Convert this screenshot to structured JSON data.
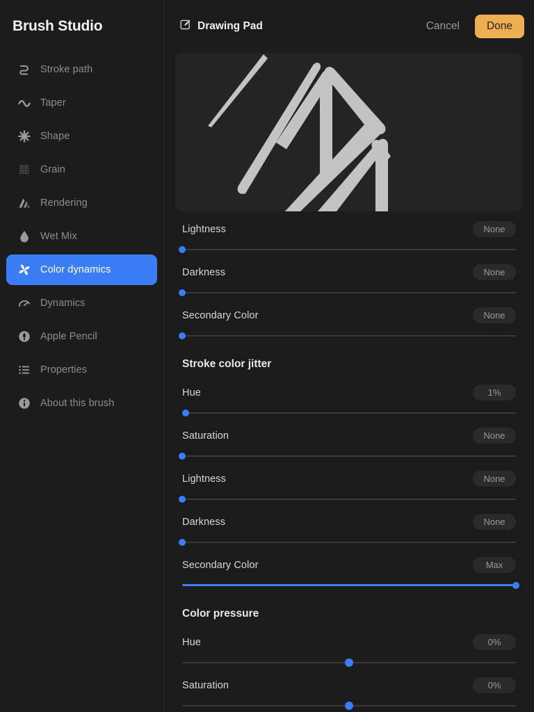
{
  "sidebar": {
    "brand": "Brush Studio",
    "items": [
      {
        "label": "Stroke path",
        "icon": "stroke-path-icon",
        "active": false
      },
      {
        "label": "Taper",
        "icon": "taper-wave-icon",
        "active": false
      },
      {
        "label": "Shape",
        "icon": "shape-starburst-icon",
        "active": false
      },
      {
        "label": "Grain",
        "icon": "grain-texture-icon",
        "active": false
      },
      {
        "label": "Rendering",
        "icon": "rendering-icon",
        "active": false
      },
      {
        "label": "Wet Mix",
        "icon": "water-drop-icon",
        "active": false
      },
      {
        "label": "Color dynamics",
        "icon": "color-dynamics-icon",
        "active": true
      },
      {
        "label": "Dynamics",
        "icon": "speedometer-icon",
        "active": false
      },
      {
        "label": "Apple Pencil",
        "icon": "apple-pencil-icon",
        "active": false
      },
      {
        "label": "Properties",
        "icon": "list-icon",
        "active": false
      },
      {
        "label": "About this brush",
        "icon": "info-icon",
        "active": false
      }
    ]
  },
  "topbar": {
    "edit_icon": "compose-edit-icon",
    "title": "Drawing Pad",
    "cancel_label": "Cancel",
    "done_label": "Done"
  },
  "preview": {
    "name": "brush-stroke-preview",
    "stroke_color": "#c3c3c3",
    "background": "#242424"
  },
  "colors": {
    "accent_blue": "#3b7df5",
    "accent_orange": "#efae52",
    "sidebar_bg": "#1c1c1c",
    "main_bg": "#1b1b1b",
    "pill_bg": "#2a2a2a"
  },
  "sections": [
    {
      "heading": "",
      "rows": [
        {
          "label": "Lightness",
          "value": "None",
          "percent": 0,
          "centered": false
        },
        {
          "label": "Darkness",
          "value": "None",
          "percent": 0,
          "centered": false
        },
        {
          "label": "Secondary Color",
          "value": "None",
          "percent": 0,
          "centered": false
        }
      ]
    },
    {
      "heading": "Stroke color jitter",
      "rows": [
        {
          "label": "Hue",
          "value": "1%",
          "percent": 1,
          "centered": false
        },
        {
          "label": "Saturation",
          "value": "None",
          "percent": 0,
          "centered": false
        },
        {
          "label": "Lightness",
          "value": "None",
          "percent": 0,
          "centered": false
        },
        {
          "label": "Darkness",
          "value": "None",
          "percent": 0,
          "centered": false
        },
        {
          "label": "Secondary Color",
          "value": "Max",
          "percent": 100,
          "centered": false
        }
      ]
    },
    {
      "heading": "Color pressure",
      "rows": [
        {
          "label": "Hue",
          "value": "0%",
          "percent": 50,
          "centered": true
        },
        {
          "label": "Saturation",
          "value": "0%",
          "percent": 50,
          "centered": true
        }
      ]
    }
  ]
}
